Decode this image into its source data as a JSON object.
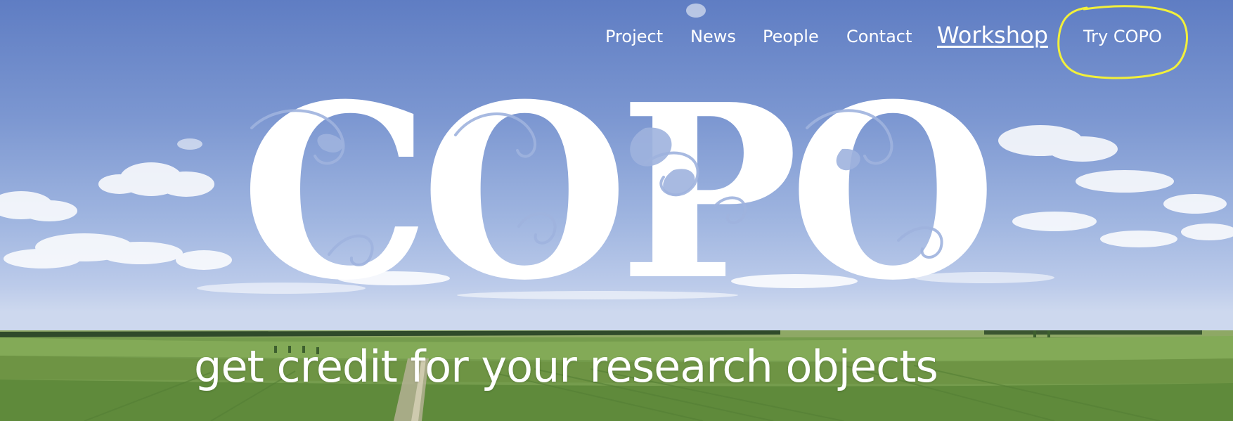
{
  "nav": {
    "items": [
      {
        "label": "Project"
      },
      {
        "label": "News"
      },
      {
        "label": "People"
      },
      {
        "label": "Contact"
      },
      {
        "label": "Workshop"
      },
      {
        "label": "Try COPO"
      }
    ]
  },
  "hero": {
    "logo_text": "COPO",
    "tagline": "get credit for your research objects"
  },
  "colors": {
    "sky_top": "#5f7dc3",
    "sky_horizon": "#cdd8ee",
    "field_green": "#6f9a4a",
    "annotation_yellow": "#f2f03a",
    "text": "#ffffff"
  },
  "icons": {
    "leaf": "leaf-icon",
    "swirl": "swirl-ornament"
  }
}
